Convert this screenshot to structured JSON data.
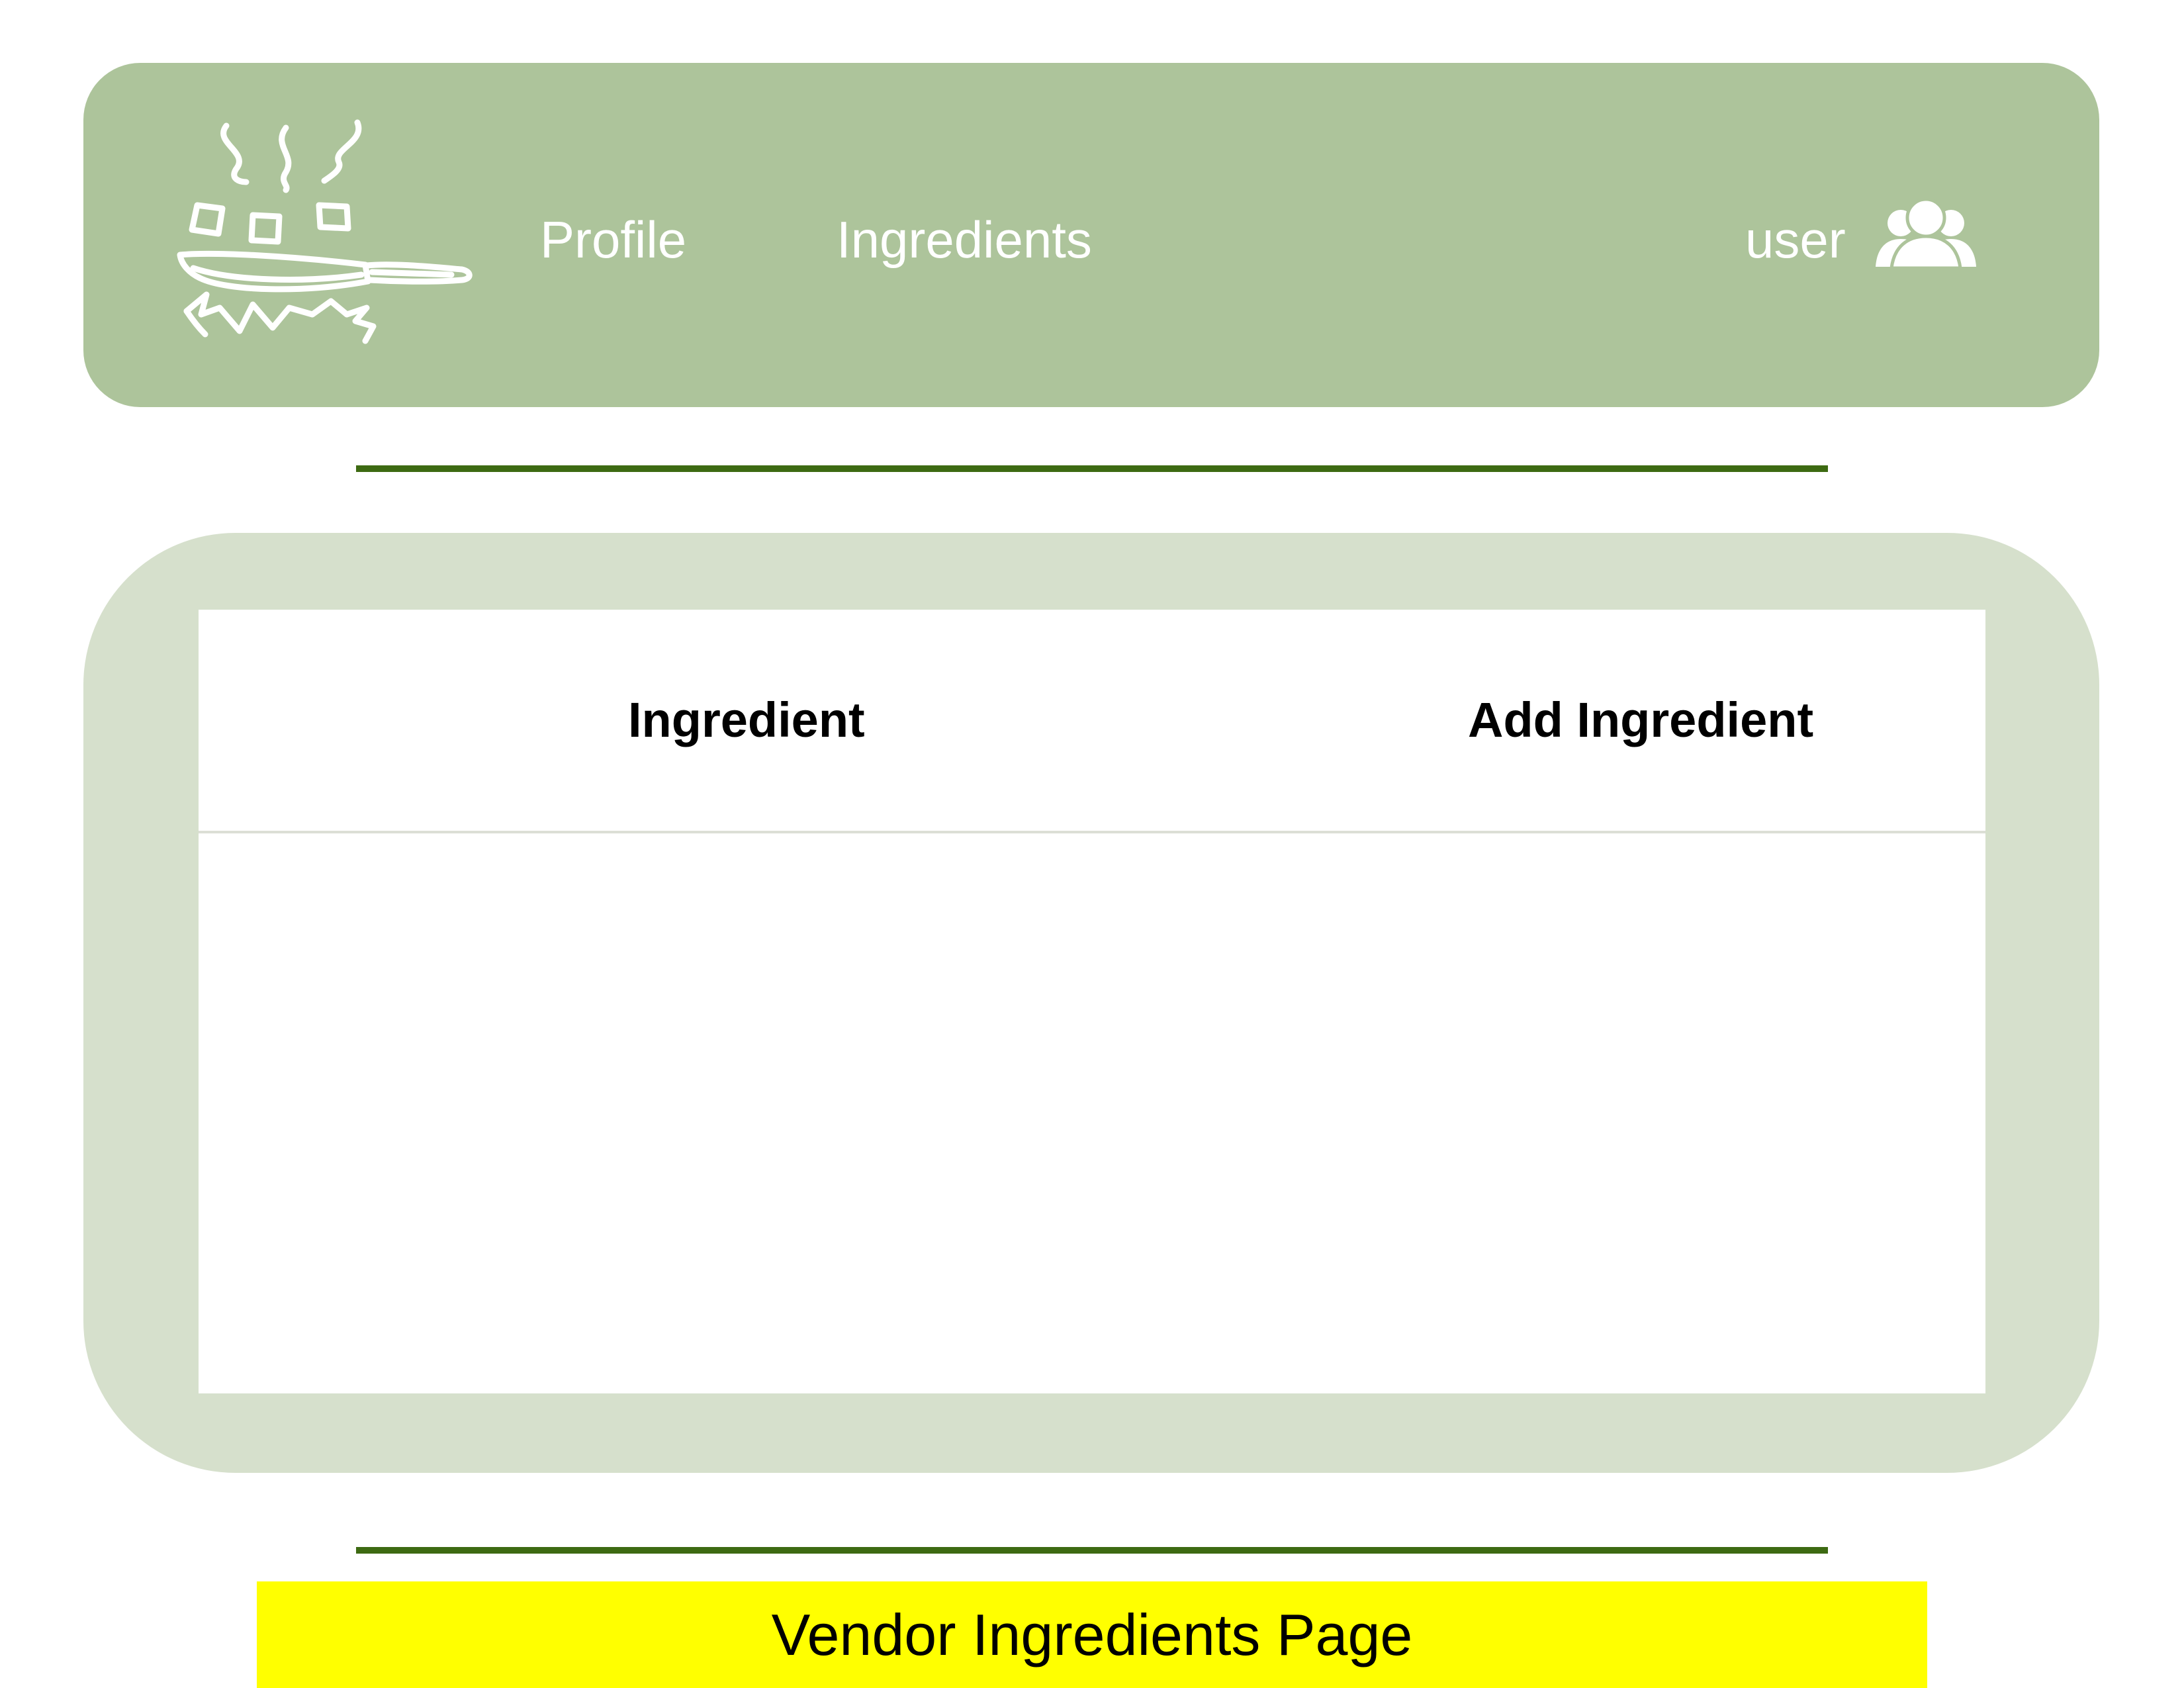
{
  "header": {
    "logo_icon": "frying-pan-icon",
    "nav": {
      "profile_label": "Profile",
      "ingredients_label": "Ingredients"
    },
    "user_label": "user",
    "user_icon": "users-group-icon"
  },
  "table": {
    "columns": {
      "ingredient": "Ingredient",
      "add_ingredient": "Add Ingredient"
    },
    "rows": []
  },
  "caption": {
    "text": "Vendor Ingredients Page"
  },
  "colors": {
    "header_bg": "#adc49b",
    "panel_bg": "#d6e0cc",
    "divider": "#3d6a12",
    "caption_bg": "#ffff00"
  }
}
